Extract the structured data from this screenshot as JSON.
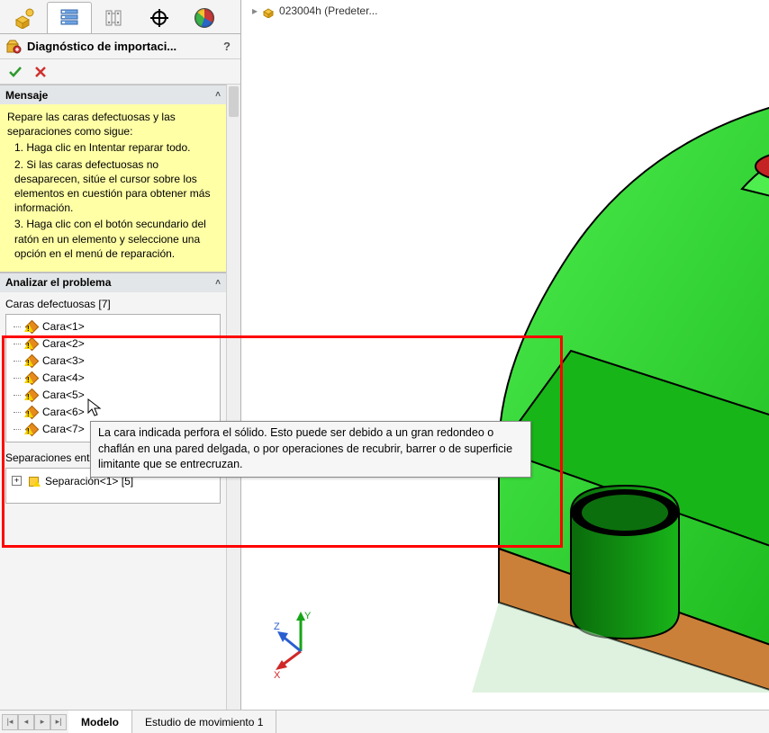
{
  "breadcrumb": {
    "label": "023004h  (Predeter..."
  },
  "feature": {
    "title": "Diagnóstico de importaci...",
    "help_icon": "?"
  },
  "actions": {
    "accept": "✓",
    "cancel": "✕"
  },
  "message": {
    "header": "Mensaje",
    "intro": "Repare las caras defectuosas y las separaciones como sigue:",
    "step1": "1. Haga clic en Intentar reparar todo.",
    "step2": "2. Si las caras defectuosas no desaparecen, sitúe el cursor sobre los elementos en cuestión para obtener más información.",
    "step3": "3. Haga clic con el botón secundario del ratón en un elemento y seleccione una opción en el menú de reparación."
  },
  "analyze": {
    "header": "Analizar el problema",
    "faces_label": "Caras defectuosas [7]",
    "faces": [
      {
        "name": "Cara<1>"
      },
      {
        "name": "Cara<2>"
      },
      {
        "name": "Cara<3>"
      },
      {
        "name": "Cara<4>"
      },
      {
        "name": "Cara<5>"
      },
      {
        "name": "Cara<6>"
      },
      {
        "name": "Cara<7>"
      }
    ],
    "gaps_label": "Separaciones entre las caras [1]",
    "gap_item": "Separación<1> [5]"
  },
  "tooltip": "La cara indicada perfora el sólido. Esto puede ser debido a un gran redondeo o chaflán en una pared delgada, o por operaciones de recubrir, barrer o de superficie limitante que se entrecruzan.",
  "bottom_tabs": {
    "model": "Modelo",
    "study": "Estudio de movimiento 1"
  },
  "triad": {
    "x": "X",
    "y": "Y",
    "z": "Z"
  },
  "colors": {
    "highlight": "#ff0000",
    "msg_bg": "#ffffa6",
    "model_green": "#18b519",
    "model_green_light": "#4eee4f",
    "model_brown": "#c97a2f"
  }
}
